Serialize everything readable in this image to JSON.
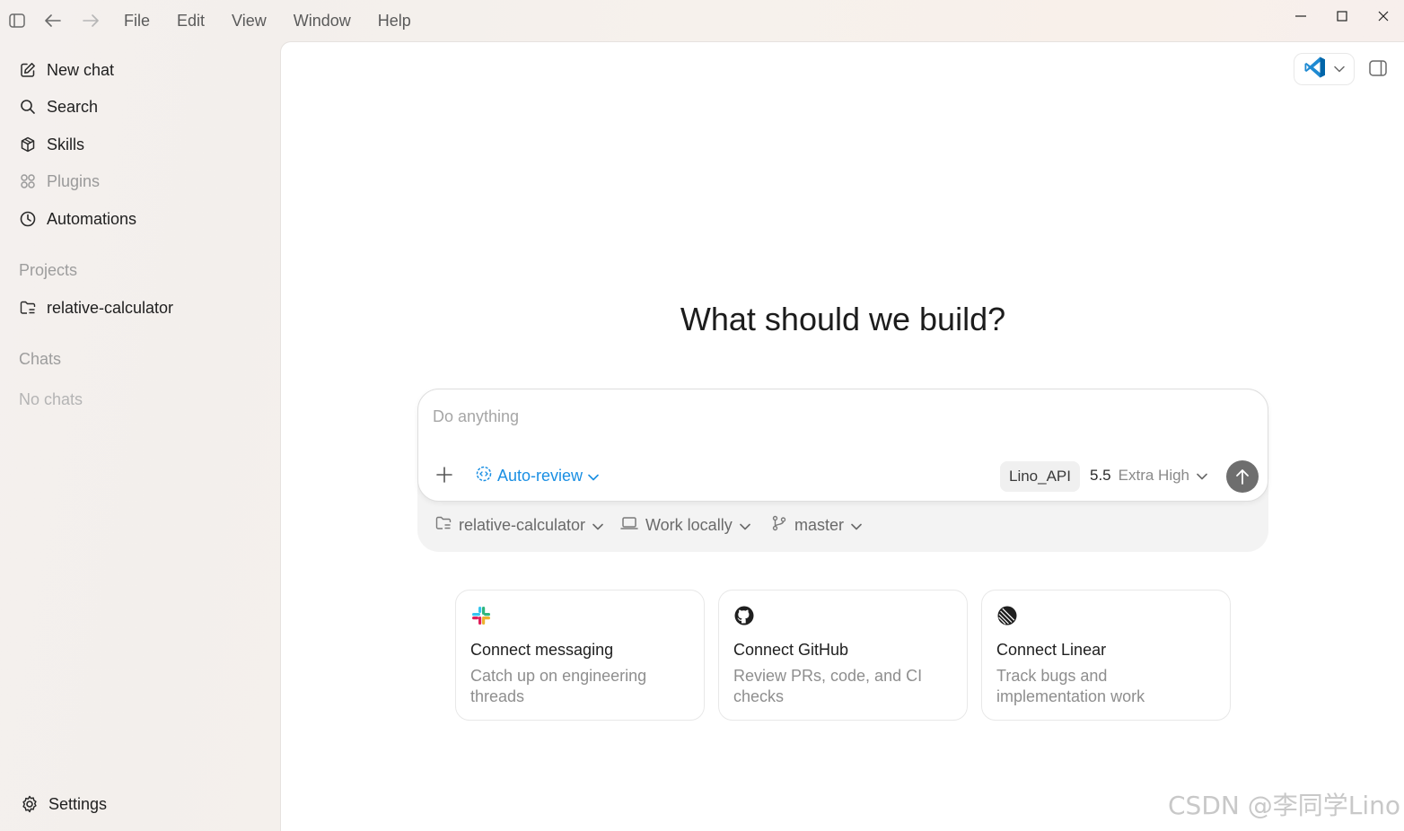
{
  "menu": [
    "File",
    "Edit",
    "View",
    "Window",
    "Help"
  ],
  "sidebar": {
    "nav": [
      {
        "label": "New chat",
        "icon": "edit-icon"
      },
      {
        "label": "Search",
        "icon": "search-icon"
      },
      {
        "label": "Skills",
        "icon": "cube-icon"
      },
      {
        "label": "Plugins",
        "icon": "grid-icon"
      },
      {
        "label": "Automations",
        "icon": "clock-icon"
      }
    ],
    "projects_label": "Projects",
    "project": "relative-calculator",
    "chats_label": "Chats",
    "no_chats": "No chats",
    "settings": "Settings"
  },
  "main": {
    "heading": "What should we build?",
    "composer": {
      "placeholder": "Do anything",
      "auto_review": "Auto-review",
      "api_chip": "Lino_API",
      "model_version": "5.5",
      "model_level": "Extra High",
      "accent": "#1a8fe3"
    },
    "options": {
      "project": "relative-calculator",
      "location": "Work locally",
      "branch": "master"
    },
    "cards": [
      {
        "title": "Connect messaging",
        "desc": "Catch up on engineering threads",
        "icon": "slack-icon"
      },
      {
        "title": "Connect GitHub",
        "desc": "Review PRs, code, and CI checks",
        "icon": "github-icon"
      },
      {
        "title": "Connect Linear",
        "desc": "Track bugs and implementation work",
        "icon": "linear-icon"
      }
    ]
  },
  "watermark": "CSDN @李同学Lino"
}
